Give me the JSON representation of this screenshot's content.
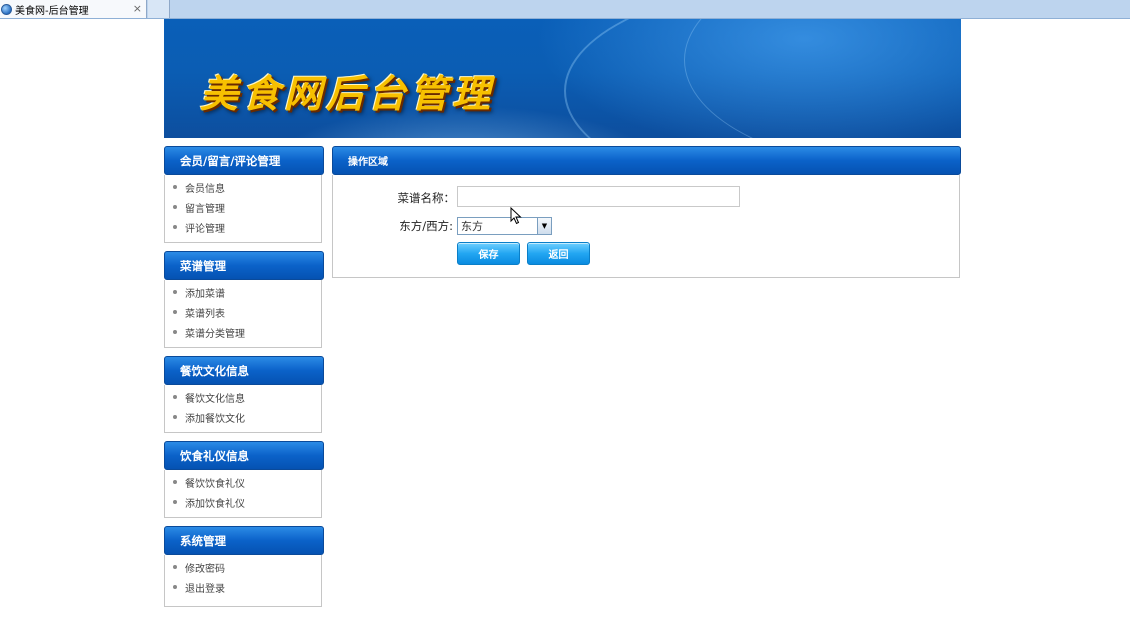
{
  "browser": {
    "tab_title": "美食网-后台管理",
    "close_glyph": "×"
  },
  "banner": {
    "title": "美食网后台管理"
  },
  "sidebar": {
    "sections": [
      {
        "title": "会员/留言/评论管理",
        "items": [
          "会员信息",
          "留言管理",
          "评论管理"
        ]
      },
      {
        "title": "菜谱管理",
        "items": [
          "添加菜谱",
          "菜谱列表",
          "菜谱分类管理"
        ]
      },
      {
        "title": "餐饮文化信息",
        "items": [
          "餐饮文化信息",
          "添加餐饮文化"
        ]
      },
      {
        "title": "饮食礼仪信息",
        "items": [
          "餐饮饮食礼仪",
          "添加饮食礼仪"
        ]
      },
      {
        "title": "系统管理",
        "items": [
          "修改密码",
          "退出登录"
        ]
      }
    ]
  },
  "main": {
    "header": "操作区域",
    "form": {
      "name_label": "菜谱名称：",
      "name_value": "",
      "type_label": "东方/西方:",
      "type_selected": "东方",
      "save_label": "保存",
      "back_label": "返回"
    }
  },
  "colors": {
    "header_blue": "#0b62c9",
    "button_blue": "#22a6f2",
    "title_gold": "#f7c000"
  }
}
